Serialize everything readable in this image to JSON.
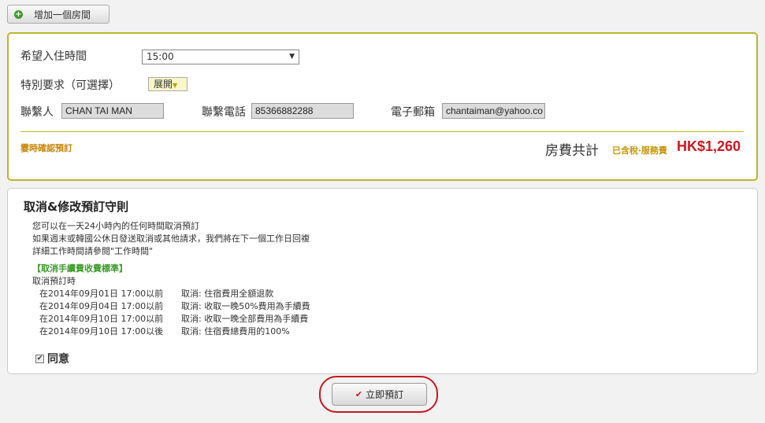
{
  "add_room": {
    "label": "增加一個房間"
  },
  "booking": {
    "checkin_label": "希望入住時間",
    "checkin_value": "15:00",
    "special_label": "特別要求（可選擇）",
    "expand_label": "展開",
    "contact_label": "聯繫人",
    "contact_value": "CHAN TAI MAN",
    "phone_label": "聯繫電話",
    "phone_value": "85366882288",
    "email_label": "電子郵箱",
    "email_value": "chantaiman@yahoo.co",
    "instant_confirm": "霎時確認預訂",
    "total_label": "房費共計",
    "total_note": "已含稅‧服務費",
    "total_amount": "HK$1,260"
  },
  "policy": {
    "title": "取消&修改預訂守則",
    "lines": [
      "您可以在一天24小時內的任何時間取消預訂",
      "如果週末或韓國公休日發送取消或其他請求，我們將在下一個工作日回複",
      "詳細工作時間請參閱\"工作時間\""
    ],
    "fee_header": "【取消手續費收費標準】",
    "time_header": "取消預訂時",
    "rows": [
      {
        "when": "在2014年09月01日 17:00以前",
        "what": "取消: 住宿費用全額退款"
      },
      {
        "when": "在2014年09月04日 17:00以前",
        "what": "取消: 收取一晚50%費用為手續費"
      },
      {
        "when": "在2014年09月10日 17:00以前",
        "what": "取消: 收取一晚全部費用為手續費"
      },
      {
        "when": "在2014年09月10日 17:00以後",
        "what": "取消: 住宿費總費用的100%"
      }
    ],
    "agree_label": "同意"
  },
  "book_button": {
    "label": "立即預訂"
  }
}
